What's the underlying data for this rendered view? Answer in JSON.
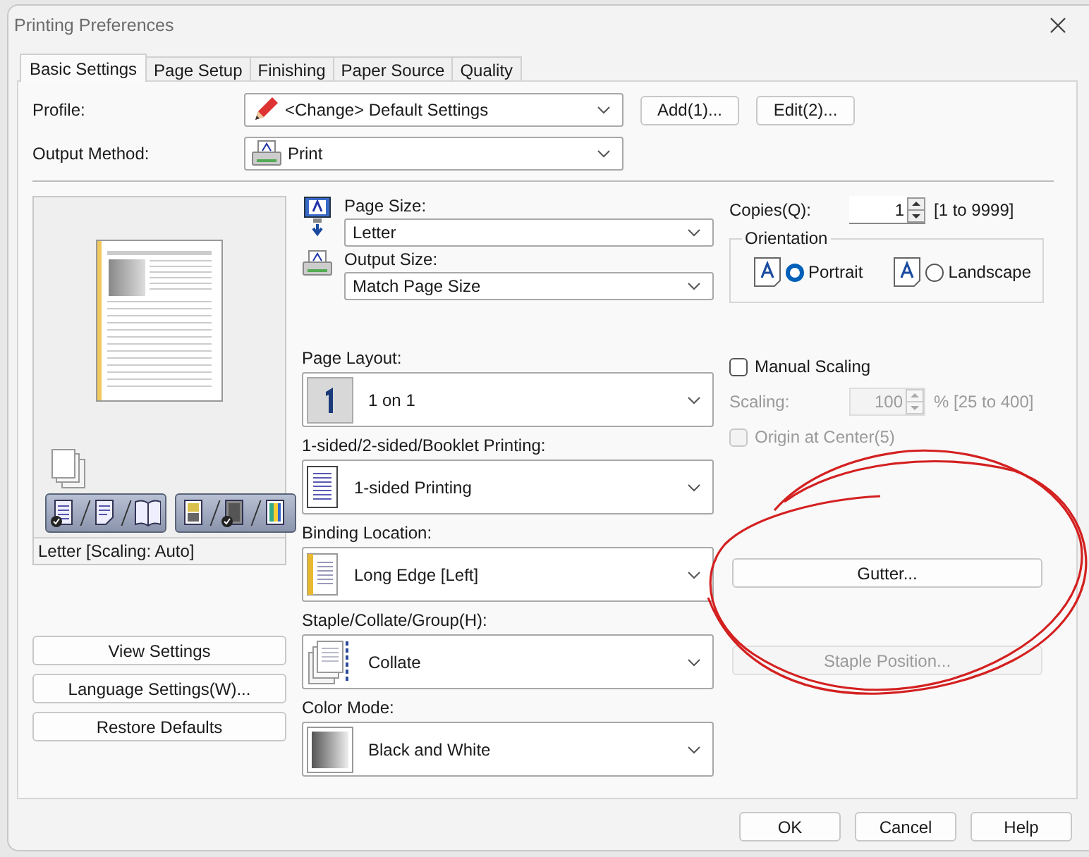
{
  "window": {
    "title": "Printing Preferences"
  },
  "tabs": [
    {
      "label": "Basic Settings",
      "selected": true
    },
    {
      "label": "Page Setup",
      "selected": false
    },
    {
      "label": "Finishing",
      "selected": false
    },
    {
      "label": "Paper Source",
      "selected": false
    },
    {
      "label": "Quality",
      "selected": false
    }
  ],
  "profile": {
    "label": "Profile:",
    "value": "<Change> Default Settings",
    "buttons": [
      "Add(1)...",
      "Edit(2)..."
    ]
  },
  "output_method": {
    "label": "Output Method:",
    "value": "Print"
  },
  "preview": {
    "status": "Letter [Scaling: Auto]"
  },
  "view_toggles": [
    {
      "options": [
        {
          "kind": "page",
          "selected": true
        },
        {
          "kind": "document",
          "selected": false
        },
        {
          "kind": "booklet",
          "selected": false
        }
      ]
    },
    {
      "options": [
        {
          "kind": "blocks",
          "selected": false
        },
        {
          "kind": "gradient",
          "selected": true
        },
        {
          "kind": "rainbow",
          "selected": false
        }
      ]
    }
  ],
  "left_buttons": [
    "View Settings",
    "Language Settings(W)...",
    "Restore Defaults"
  ],
  "size_settings": [
    {
      "kind": "page",
      "label": "Page Size:",
      "value": "Letter"
    },
    {
      "kind": "output",
      "label": "Output Size:",
      "value": "Match Page Size"
    }
  ],
  "options": [
    {
      "kind": "layout",
      "label": "Page Layout:",
      "value": "1 on 1"
    },
    {
      "kind": "sided",
      "label": "1-sided/2-sided/Booklet Printing:",
      "value": "1-sided Printing"
    },
    {
      "kind": "binding",
      "label": "Binding Location:",
      "value": "Long Edge [Left]"
    },
    {
      "kind": "staple",
      "label": "Staple/Collate/Group(H):",
      "value": "Collate"
    },
    {
      "kind": "color",
      "label": "Color Mode:",
      "value": "Black and White"
    }
  ],
  "copies": {
    "label": "Copies(Q):",
    "value": "1",
    "range": "[1 to 9999]"
  },
  "orientation": {
    "title": "Orientation",
    "options": [
      {
        "label": "Portrait",
        "selected": true
      },
      {
        "label": "Landscape",
        "selected": false
      }
    ]
  },
  "manual_scaling": {
    "label": "Manual Scaling",
    "checked": false
  },
  "scaling": {
    "label": "Scaling:",
    "value": "100",
    "range": "% [25 to 400]",
    "disabled": true
  },
  "origin_at_center": {
    "label": "Origin at Center(5)",
    "checked": false,
    "disabled": true
  },
  "gutter_button": {
    "label": "Gutter...",
    "disabled": false
  },
  "staple_position_button": {
    "label": "Staple Position...",
    "disabled": true
  },
  "dialog_buttons": [
    "OK",
    "Cancel",
    "Help"
  ]
}
